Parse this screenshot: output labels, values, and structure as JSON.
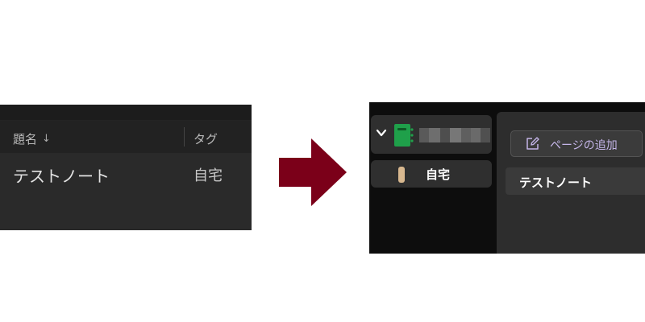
{
  "left_table": {
    "columns": [
      {
        "label": "題名",
        "sort_icon": "arrow-down-icon"
      },
      {
        "label": "タグ"
      }
    ],
    "rows": [
      {
        "title": "テストノート",
        "tag": "自宅"
      }
    ]
  },
  "arrow": {
    "icon": "right-arrow-icon",
    "color": "#7b0019"
  },
  "right_sidebar": {
    "notebook": {
      "expanded": true,
      "icon": "notebook-icon",
      "icon_color": "#1fa04a"
    },
    "section": {
      "label": "自宅",
      "icon": "section-tab-icon",
      "color": "#d8b88f"
    }
  },
  "page_list": {
    "add_page_label": "ページの追加",
    "add_page_icon": "edit-icon",
    "accent_color": "#c4b5e8",
    "pages": [
      {
        "title": "テストノート"
      }
    ]
  }
}
